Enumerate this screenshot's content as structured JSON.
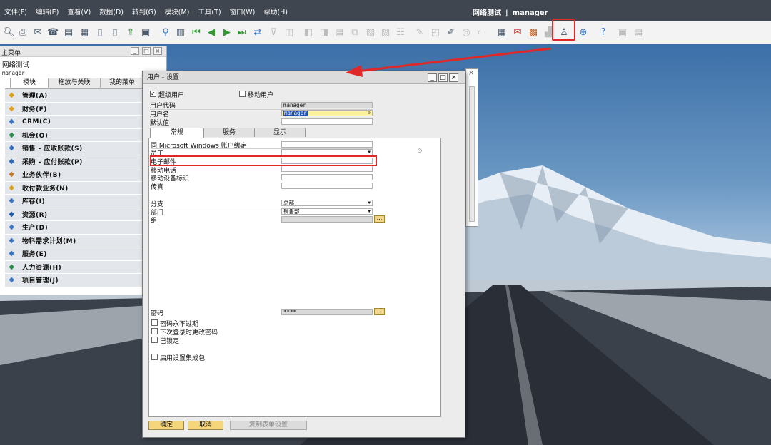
{
  "menubar": {
    "items": [
      "文件(F)",
      "编辑(E)",
      "查看(V)",
      "数据(D)",
      "转到(G)",
      "模块(M)",
      "工具(T)",
      "窗口(W)",
      "帮助(H)"
    ],
    "company": "网络测试",
    "separator": "|",
    "user": "manager"
  },
  "toolbar": {
    "icons": [
      "preview-icon",
      "print-icon",
      "email-icon",
      "fax-icon",
      "export-icon",
      "excel-icon",
      "doc-icon",
      "pdf-icon",
      "filter-icon",
      "lock-icon",
      "find-icon",
      "add-icon",
      "first-record-icon",
      "prev-record-icon",
      "next-record-icon",
      "last-record-icon",
      "refresh-icon",
      "sort-icon",
      "pick-icon",
      "base-doc-icon",
      "target-doc-icon",
      "journal-icon",
      "duplicate-icon",
      "layout-icon",
      "edit-icon",
      "settings-icon",
      "trace-icon",
      "form-settings-icon",
      "message-icon",
      "alert-icon",
      "calendar-icon",
      "inbox-icon",
      "calculator-icon",
      "organizer-icon",
      "users-icon",
      "web-icon",
      "help-icon",
      "tile-icon",
      "cascade-icon"
    ]
  },
  "mainmenu": {
    "title": "主菜单",
    "company": "网络测试",
    "user": "manager",
    "tabs": [
      "模块",
      "拖放与关联",
      "我的菜单"
    ],
    "items": [
      {
        "icon": "admin-icon",
        "label": "管理(A)",
        "color": "#d9a21c"
      },
      {
        "icon": "finance-icon",
        "label": "财务(F)",
        "color": "#e0a020"
      },
      {
        "icon": "crm-icon",
        "label": "CRM(C)",
        "color": "#3a76c4"
      },
      {
        "icon": "opportunity-icon",
        "label": "机会(O)",
        "color": "#2a8a4a"
      },
      {
        "icon": "sales-icon",
        "label": "销售 - 应收账款(S)",
        "color": "#2e6cc0"
      },
      {
        "icon": "purchase-icon",
        "label": "采购 - 应付账款(P)",
        "color": "#2e6cc0"
      },
      {
        "icon": "partner-icon",
        "label": "业务伙伴(B)",
        "color": "#c07a30"
      },
      {
        "icon": "banking-icon",
        "label": "收付款业务(N)",
        "color": "#d9a21c"
      },
      {
        "icon": "inventory-icon",
        "label": "库存(I)",
        "color": "#3a76c4"
      },
      {
        "icon": "resources-icon",
        "label": "资源(R)",
        "color": "#1e5aa8"
      },
      {
        "icon": "production-icon",
        "label": "生产(D)",
        "color": "#3a76c4"
      },
      {
        "icon": "mrp-icon",
        "label": "物料需求计划(M)",
        "color": "#3a76c4"
      },
      {
        "icon": "service-icon",
        "label": "服务(E)",
        "color": "#3a76c4"
      },
      {
        "icon": "hr-icon",
        "label": "人力资源(H)",
        "color": "#2a8a4a"
      },
      {
        "icon": "project-icon",
        "label": "项目管理(J)",
        "color": "#3a76c4"
      }
    ]
  },
  "dialog": {
    "title": "用户 - 设置",
    "superuser_label": "超级用户",
    "superuser_checked": "✓",
    "mobile_user_label": "移动用户",
    "user_code_label": "用户代码",
    "user_code_value": "manager",
    "user_name_label": "用户名",
    "user_name_value": "manager",
    "defaults_label": "默认值",
    "tabs": [
      "常规",
      "服务",
      "显示"
    ],
    "general": {
      "windows_account_label": "同 Microsoft Windows 账户绑定",
      "employee_label": "员工",
      "email_label": "电子邮件",
      "mobile_phone_label": "移动电话",
      "mobile_device_label": "移动设备标识",
      "fax_label": "传真",
      "branch_label": "分支",
      "branch_value": "总部",
      "department_label": "部门",
      "department_value": "销售部",
      "group_label": "组",
      "ellipsis": "...",
      "password_label": "密码",
      "password_value": "****",
      "never_expire_label": "密码永不过期",
      "change_next_login_label": "下次登录时更改密码",
      "locked_label": "已锁定",
      "enable_package_label": "启用设置集成包"
    },
    "buttons": {
      "ok": "确定",
      "cancel": "取消",
      "copy_form_settings": "复制表单设置"
    }
  }
}
